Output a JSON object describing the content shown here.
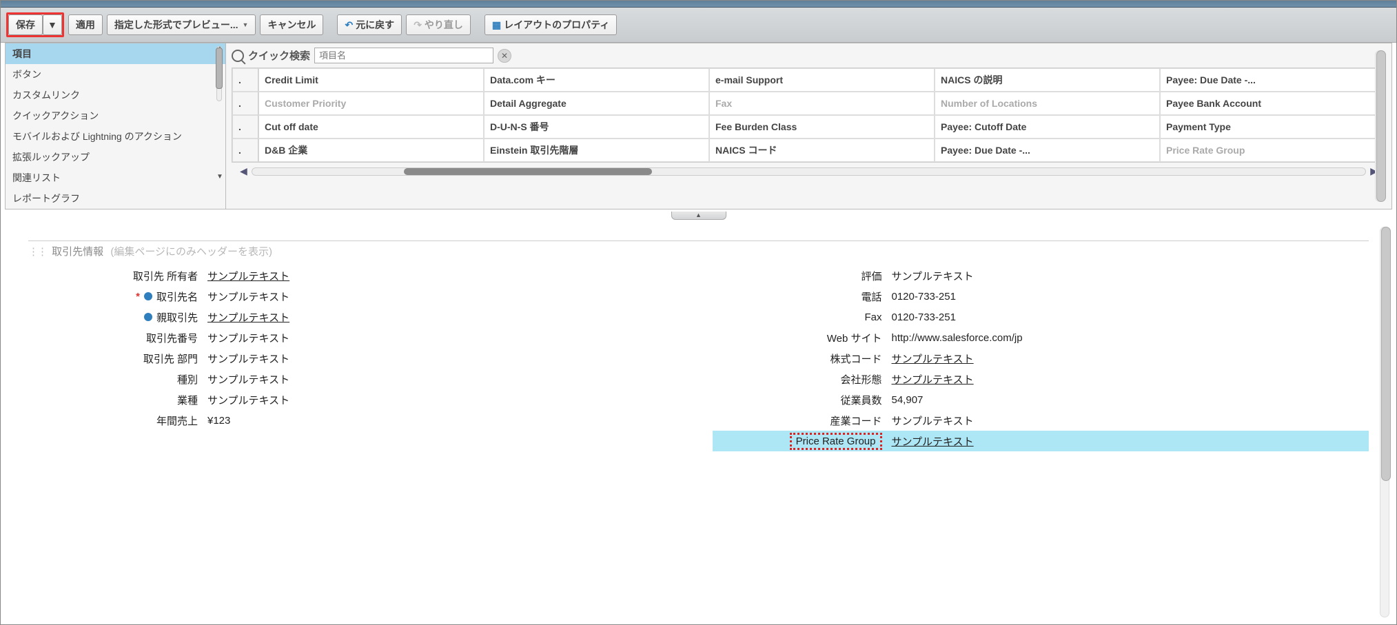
{
  "toolbar": {
    "save": "保存",
    "apply": "適用",
    "preview": "指定した形式でプレビュー...",
    "cancel": "キャンセル",
    "undo": "元に戻す",
    "redo": "やり直し",
    "layout_props": "レイアウトのプロパティ"
  },
  "sidebar": {
    "items": [
      "項目",
      "ボタン",
      "カスタムリンク",
      "クイックアクション",
      "モバイルおよび Lightning のアクション",
      "拡張ルックアップ",
      "関連リスト",
      "レポートグラフ"
    ],
    "selected_index": 0
  },
  "search": {
    "label": "クイック検索",
    "placeholder": "項目名"
  },
  "field_grid": {
    "cols": [
      [
        "Credit Limit",
        "Customer Priority",
        "Cut off date",
        "D&B 企業"
      ],
      [
        "Data.com キー",
        "Detail Aggregate",
        "D-U-N-S 番号",
        "Einstein 取引先階層"
      ],
      [
        "e-mail Support",
        "Fax",
        "Fee Burden Class",
        "NAICS コード"
      ],
      [
        "NAICS の説明",
        "Number of Locations",
        "Payee: Cutoff Date",
        "Payee: Due Date -..."
      ],
      [
        "Payee: Due Date -...",
        "Payee Bank Account",
        "Payment Type",
        "Price Rate Group"
      ]
    ],
    "dim_cells": [
      "Customer Priority",
      "Fax",
      "Number of Locations",
      "Price Rate Group"
    ]
  },
  "section": {
    "title": "取引先情報",
    "subtitle": "(編集ページにのみヘッダーを表示)"
  },
  "left_fields": [
    {
      "label": "取引先 所有者",
      "value": "サンプルテキスト",
      "link": true
    },
    {
      "label": "取引先名",
      "value": "サンプルテキスト",
      "required": true,
      "dot": true
    },
    {
      "label": "親取引先",
      "value": "サンプルテキスト",
      "link": true,
      "dot": true
    },
    {
      "label": "取引先番号",
      "value": "サンプルテキスト"
    },
    {
      "label": "取引先 部門",
      "value": "サンプルテキスト"
    },
    {
      "label": "種別",
      "value": "サンプルテキスト"
    },
    {
      "label": "業種",
      "value": "サンプルテキスト"
    },
    {
      "label": "年間売上",
      "value": "¥123"
    }
  ],
  "right_fields": [
    {
      "label": "評価",
      "value": "サンプルテキスト"
    },
    {
      "label": "電話",
      "value": "0120-733-251"
    },
    {
      "label": "Fax",
      "value": "0120-733-251"
    },
    {
      "label": "Web サイト",
      "value": "http://www.salesforce.com/jp"
    },
    {
      "label": "株式コード",
      "value": "サンプルテキスト",
      "link": true
    },
    {
      "label": "会社形態",
      "value": "サンプルテキスト",
      "link": true
    },
    {
      "label": "従業員数",
      "value": "54,907"
    },
    {
      "label": "産業コード",
      "value": "サンプルテキスト"
    },
    {
      "label": "Price Rate Group",
      "value": "サンプルテキスト",
      "link": true,
      "highlight": true,
      "marker": true
    }
  ]
}
